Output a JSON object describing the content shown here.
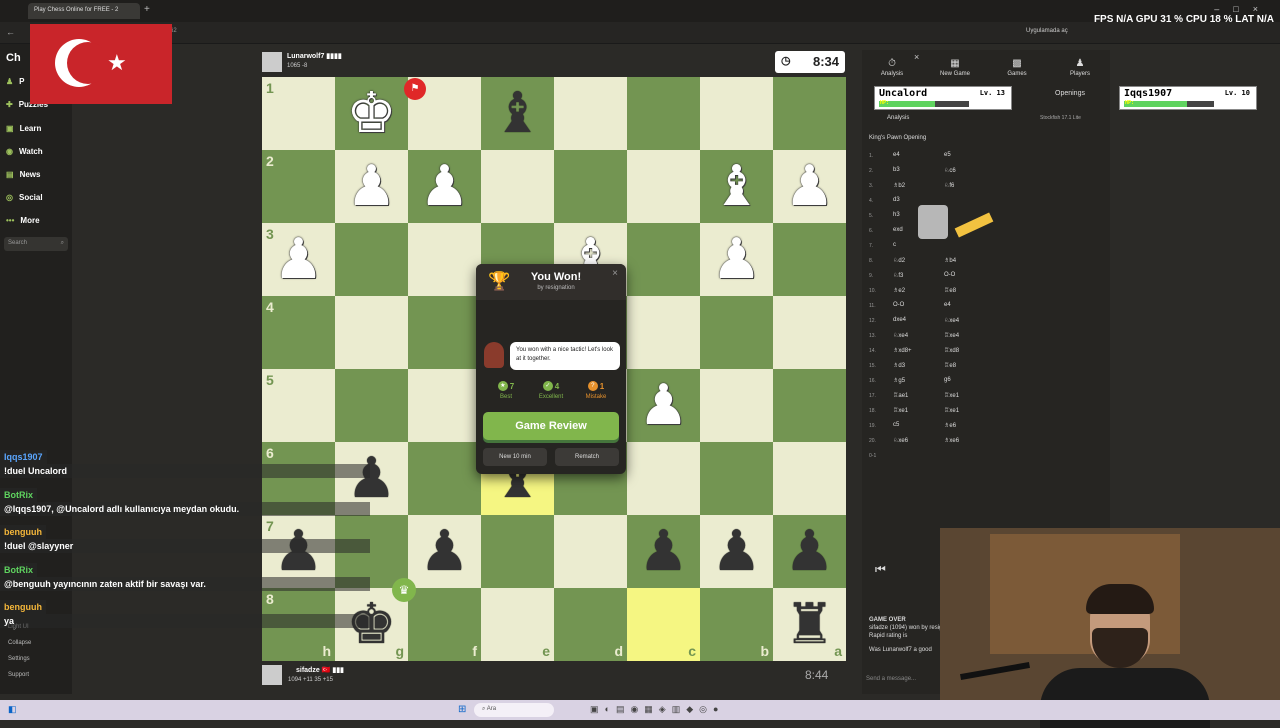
{
  "browser": {
    "tab_title": "Play Chess Online for FREE - 2",
    "url_fragment": "62",
    "apps_label": "Uygulamada aç",
    "hud": "FPS N/A GPU 31 % CPU 18 % LAT N/A"
  },
  "sidebar": {
    "logo": "Ch",
    "items": [
      {
        "label": "P",
        "icon": "♟"
      },
      {
        "label": "Puzzles",
        "icon": "✚"
      },
      {
        "label": "Learn",
        "icon": "▣"
      },
      {
        "label": "Watch",
        "icon": "◉"
      },
      {
        "label": "News",
        "icon": "▤"
      },
      {
        "label": "Social",
        "icon": "◎"
      },
      {
        "label": "More",
        "icon": "•••"
      }
    ],
    "search_placeholder": "Search",
    "bottom": [
      "Light UI",
      "Collapse",
      "Settings",
      "Support"
    ]
  },
  "top_player": {
    "name": "Lunarwolf7 ▮▮▮▮",
    "rating": "1065 -8",
    "clock": "8:34"
  },
  "bottom_player": {
    "name": "sifadze 🇹🇷 ▮▮▮",
    "rating": "1094 +11   35 +15",
    "clock": "8:44"
  },
  "board": {
    "ranks": [
      "1",
      "2",
      "3",
      "4",
      "5",
      "6",
      "7",
      "8"
    ],
    "files": [
      "h",
      "g",
      "f",
      "e",
      "d",
      "c",
      "b",
      "a"
    ]
  },
  "modal": {
    "title": "You Won!",
    "subtitle": "by resignation",
    "coach_message": "You won with a nice tactic! Let's look at it together.",
    "stats": [
      {
        "count": "7",
        "label": "Best",
        "color": "#81b64c",
        "icon": "★"
      },
      {
        "count": "4",
        "label": "Excellent",
        "color": "#81b64c",
        "icon": "👍"
      },
      {
        "count": "1",
        "label": "Mistake",
        "color": "#e6912c",
        "icon": "?"
      }
    ],
    "review_button": "Game Review",
    "new_game_button": "New 10 min",
    "rematch_button": "Rematch"
  },
  "right_panel": {
    "tabs": [
      {
        "label": "Analysis",
        "icon": "⏱"
      },
      {
        "label": "New Game",
        "icon": "▦"
      },
      {
        "label": "Games",
        "icon": "▩"
      },
      {
        "label": "Players",
        "icon": "♟"
      }
    ],
    "openings_label": "Openings",
    "analysis_label": "Analysis",
    "engine_label": "Stockfish 17.1 Lite",
    "opening_name": "King's Pawn Opening",
    "moves": [
      {
        "n": "1.",
        "w": "e4",
        "b": "e5"
      },
      {
        "n": "2.",
        "w": "b3",
        "b": "♘c6"
      },
      {
        "n": "3.",
        "w": "♗b2",
        "b": "♘f6"
      },
      {
        "n": "4.",
        "w": "d3",
        "b": ""
      },
      {
        "n": "5.",
        "w": "h3",
        "b": ""
      },
      {
        "n": "6.",
        "w": "exd",
        "b": ""
      },
      {
        "n": "7.",
        "w": "c",
        "b": ""
      },
      {
        "n": "8.",
        "w": "♘d2",
        "b": "♗b4"
      },
      {
        "n": "9.",
        "w": "♘f3",
        "b": "O-O"
      },
      {
        "n": "10.",
        "w": "♗e2",
        "b": "♖e8"
      },
      {
        "n": "11.",
        "w": "O-O",
        "b": "e4"
      },
      {
        "n": "12.",
        "w": "dxe4",
        "b": "♘xe4"
      },
      {
        "n": "13.",
        "w": "♘xe4",
        "b": "♖xe4"
      },
      {
        "n": "14.",
        "w": "♗xd8+",
        "b": "♖xd8"
      },
      {
        "n": "15.",
        "w": "♗d3",
        "b": "♖e8"
      },
      {
        "n": "16.",
        "w": "♗g5",
        "b": "g6"
      },
      {
        "n": "17.",
        "w": "♖ae1",
        "b": "♖xe1"
      },
      {
        "n": "18.",
        "w": "♖xe1",
        "b": "♖xe1"
      },
      {
        "n": "19.",
        "w": "c5",
        "b": "♗e6"
      },
      {
        "n": "20.",
        "w": "♘xe6",
        "b": "♗xe6"
      }
    ],
    "result": "0-1",
    "game_over_title": "GAME OVER",
    "game_over_text": "sifadze (1094) won by resignation. Your new Rapid rating is",
    "last_line": "Was Lunarwolf7 a good",
    "send_message_placeholder": "Send a message..."
  },
  "overlay": {
    "player1": {
      "name": "Uncalord",
      "level": "Lv. 13",
      "hp": 0.62
    },
    "player2": {
      "name": "Iqqs1907",
      "level": "Lv. 10",
      "hp": 0.7
    }
  },
  "chat": [
    {
      "user": "Iqqs1907",
      "msg": "!duel Uncalord",
      "color": "#5aa6ff"
    },
    {
      "user": "BotRix",
      "msg": "@Iqqs1907, @Uncalord adlı kullanıcıya meydan okudu.",
      "color": "#5fd35f"
    },
    {
      "user": "benguuh",
      "msg": "!duel @slayyner",
      "color": "#f4b63a"
    },
    {
      "user": "BotRix",
      "msg": "@benguuh yayıncının zaten aktif bir savaşı var.",
      "color": "#5fd35f"
    },
    {
      "user": "benguuh",
      "msg": "ya",
      "color": "#f4b63a"
    }
  ],
  "taskbar": {
    "search_placeholder": "Ara"
  }
}
